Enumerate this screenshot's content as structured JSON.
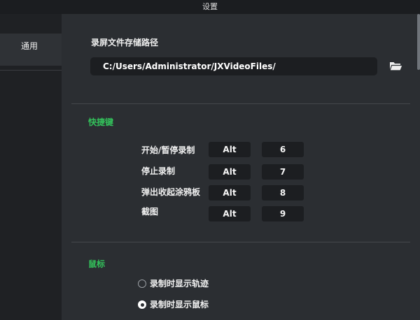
{
  "window": {
    "title": "设置"
  },
  "sidebar": {
    "items": [
      {
        "label": "通用"
      }
    ]
  },
  "storage": {
    "label": "录屏文件存储路径",
    "path": "C:/Users/Administrator/JXVideoFiles/",
    "browse_icon": "folder-open-icon"
  },
  "shortcuts": {
    "label": "快捷键",
    "rows": [
      {
        "label": "开始/暂停录制",
        "modifier": "Alt",
        "key": "6"
      },
      {
        "label": "停止录制",
        "modifier": "Alt",
        "key": "7"
      },
      {
        "label": "弹出收起涂鸦板",
        "modifier": "Alt",
        "key": "8"
      },
      {
        "label": "截图",
        "modifier": "Alt",
        "key": "9"
      }
    ]
  },
  "mouse": {
    "label": "鼠标",
    "options": [
      {
        "label": "录制时显示轨迹",
        "checked": false
      },
      {
        "label": "录制时显示鼠标",
        "checked": true
      }
    ]
  },
  "colors": {
    "accent": "#33c25b",
    "background": "#2b2e32",
    "sidebar": "#1f2124",
    "input": "#1c1e21"
  }
}
